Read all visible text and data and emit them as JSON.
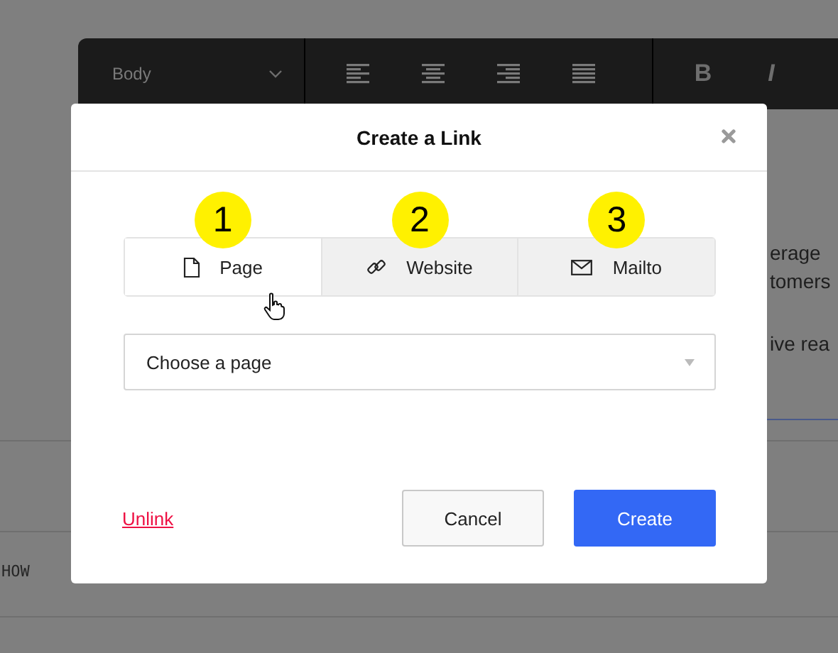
{
  "toolbar": {
    "style_dropdown": "Body",
    "alignments": [
      {
        "kind": "left"
      },
      {
        "kind": "center"
      },
      {
        "kind": "right"
      },
      {
        "kind": "justify"
      }
    ],
    "format_buttons": [
      "B",
      "I"
    ]
  },
  "background_text": {
    "lines": [
      "erage",
      "tomers",
      "ive rea"
    ],
    "code_label": "HOW"
  },
  "dialog": {
    "title": "Create a Link",
    "tabs": [
      {
        "label": "Page",
        "kind": "page",
        "selected": true,
        "callout": "1"
      },
      {
        "label": "Website",
        "kind": "website",
        "selected": false,
        "callout": "2"
      },
      {
        "label": "Mailto",
        "kind": "mailto",
        "selected": false,
        "callout": "3"
      }
    ],
    "select": {
      "placeholder": "Choose a page"
    },
    "unlink": "Unlink",
    "buttons": {
      "cancel": "Cancel",
      "create": "Create"
    }
  }
}
